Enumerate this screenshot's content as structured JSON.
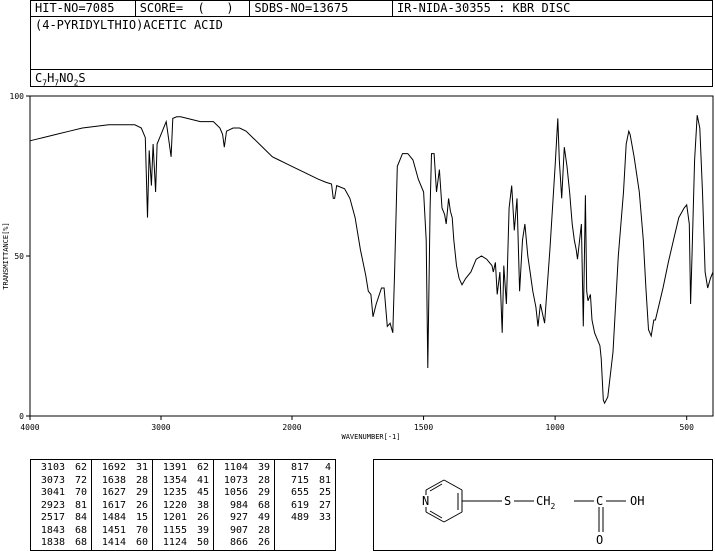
{
  "header": {
    "hit_no": "HIT-NO=7085",
    "score": "SCORE=  (   )",
    "sdbs_no": "SDBS-NO=13675",
    "ir_id": "IR-NIDA-30355 : KBR DISC",
    "compound": "(4-PYRIDYLTHIO)ACETIC ACID",
    "formula": {
      "c": "C",
      "c_n": "7",
      "h": "H",
      "h_n": "7",
      "n": "N",
      "o": "O",
      "o_n": "2",
      "s": "S"
    }
  },
  "structure": {
    "n": "N",
    "s": "S",
    "ch2": "CH",
    "ch2_n": "2",
    "c": "C",
    "oh": "OH",
    "o": "O"
  },
  "chart_data": {
    "type": "line",
    "title": "",
    "xlabel": "WAVENUMBER[-1]",
    "ylabel": "TRANSMITTANCE[%]",
    "xlim": [
      4000,
      400
    ],
    "ylim": [
      0,
      100
    ],
    "x_ticks": [
      "4000",
      "3000",
      "2000",
      "1500",
      "1000",
      "500"
    ],
    "y_ticks": [
      "100",
      "50",
      "0"
    ],
    "series": [
      {
        "x": [
          4000,
          3950,
          3900,
          3800,
          3700,
          3600,
          3500,
          3400,
          3300,
          3200,
          3150,
          3120,
          3103,
          3090,
          3073,
          3060,
          3041,
          3030,
          3000,
          2960,
          2940,
          2923,
          2910,
          2880,
          2850,
          2800,
          2750,
          2700,
          2650,
          2600,
          2550,
          2530,
          2517,
          2500,
          2450,
          2400,
          2350,
          2300,
          2250,
          2200,
          2150,
          2100,
          2050,
          2000,
          1950,
          1900,
          1870,
          1850,
          1843,
          1838,
          1830,
          1800,
          1780,
          1760,
          1740,
          1720,
          1710,
          1700,
          1692,
          1680,
          1660,
          1650,
          1638,
          1627,
          1617,
          1610,
          1600,
          1580,
          1560,
          1540,
          1520,
          1500,
          1490,
          1484,
          1475,
          1470,
          1460,
          1451,
          1440,
          1430,
          1420,
          1414,
          1405,
          1398,
          1391,
          1385,
          1375,
          1365,
          1354,
          1340,
          1320,
          1300,
          1280,
          1260,
          1250,
          1240,
          1235,
          1227,
          1220,
          1210,
          1201,
          1195,
          1185,
          1175,
          1165,
          1155,
          1145,
          1135,
          1124,
          1115,
          1104,
          1095,
          1085,
          1073,
          1065,
          1056,
          1040,
          1020,
          1000,
          990,
          984,
          975,
          965,
          955,
          945,
          935,
          927,
          920,
          915,
          907,
          900,
          893,
          885,
          880,
          875,
          866,
          860,
          850,
          840,
          830,
          825,
          820,
          817,
          812,
          800,
          780,
          760,
          740,
          730,
          720,
          715,
          700,
          680,
          665,
          655,
          645,
          635,
          625,
          619,
          610,
          590,
          570,
          550,
          530,
          510,
          500,
          490,
          485,
          480,
          470,
          460,
          450,
          440,
          430,
          420,
          410,
          400
        ],
        "y": [
          86,
          86.5,
          87,
          88,
          89,
          90,
          90.5,
          91,
          91,
          91,
          90,
          87,
          62,
          83,
          72,
          85,
          70,
          85,
          88,
          92,
          86,
          81,
          93,
          93.5,
          93.5,
          93,
          92.5,
          92,
          92,
          92,
          90,
          88,
          84,
          89,
          90,
          90,
          89,
          87,
          85,
          83,
          81,
          80,
          79,
          78,
          76,
          74,
          73,
          72.5,
          68,
          68,
          72,
          71,
          68,
          62,
          52,
          44,
          39,
          38,
          31,
          35,
          40,
          40,
          28,
          29,
          26,
          45,
          78,
          82,
          82,
          80,
          74,
          70,
          55,
          15,
          65,
          82,
          82,
          70,
          77,
          65,
          63,
          60,
          68,
          64,
          62,
          55,
          47,
          43,
          41,
          43,
          45,
          49,
          50,
          49,
          48,
          47,
          45,
          48,
          38,
          45,
          26,
          47,
          35,
          65,
          72,
          58,
          68,
          39,
          55,
          60,
          50,
          45,
          39,
          34,
          28,
          35,
          29,
          52,
          78,
          93,
          80,
          68,
          84,
          78,
          70,
          60,
          55,
          52,
          49,
          55,
          60,
          28,
          69,
          39,
          36,
          38,
          30,
          26,
          24,
          22,
          18,
          10,
          5,
          4,
          6,
          20,
          50,
          70,
          85,
          89,
          88,
          81,
          70,
          55,
          40,
          27,
          25,
          30,
          30,
          33,
          40,
          48,
          55,
          62,
          65,
          66,
          60,
          35,
          50,
          80,
          94,
          90,
          70,
          45,
          40,
          43,
          45
        ]
      }
    ]
  },
  "peak_table": [
    [
      [
        "3103",
        "62"
      ],
      [
        "3073",
        "72"
      ],
      [
        "3041",
        "70"
      ],
      [
        "2923",
        "81"
      ],
      [
        "2517",
        "84"
      ],
      [
        "1843",
        "68"
      ],
      [
        "1838",
        "68"
      ]
    ],
    [
      [
        "1692",
        "31"
      ],
      [
        "1638",
        "28"
      ],
      [
        "1627",
        "29"
      ],
      [
        "1617",
        "26"
      ],
      [
        "1484",
        "15"
      ],
      [
        "1451",
        "70"
      ],
      [
        "1414",
        "60"
      ]
    ],
    [
      [
        "1391",
        "62"
      ],
      [
        "1354",
        "41"
      ],
      [
        "1235",
        "45"
      ],
      [
        "1220",
        "38"
      ],
      [
        "1201",
        "26"
      ],
      [
        "1155",
        "39"
      ],
      [
        "1124",
        "50"
      ]
    ],
    [
      [
        "1104",
        "39"
      ],
      [
        "1073",
        "28"
      ],
      [
        "1056",
        "29"
      ],
      [
        "984",
        "68"
      ],
      [
        "927",
        "49"
      ],
      [
        "907",
        "28"
      ],
      [
        "866",
        "26"
      ]
    ],
    [
      [
        "817",
        "4"
      ],
      [
        "715",
        "81"
      ],
      [
        "655",
        "25"
      ],
      [
        "619",
        "27"
      ],
      [
        "489",
        "33"
      ]
    ]
  ]
}
